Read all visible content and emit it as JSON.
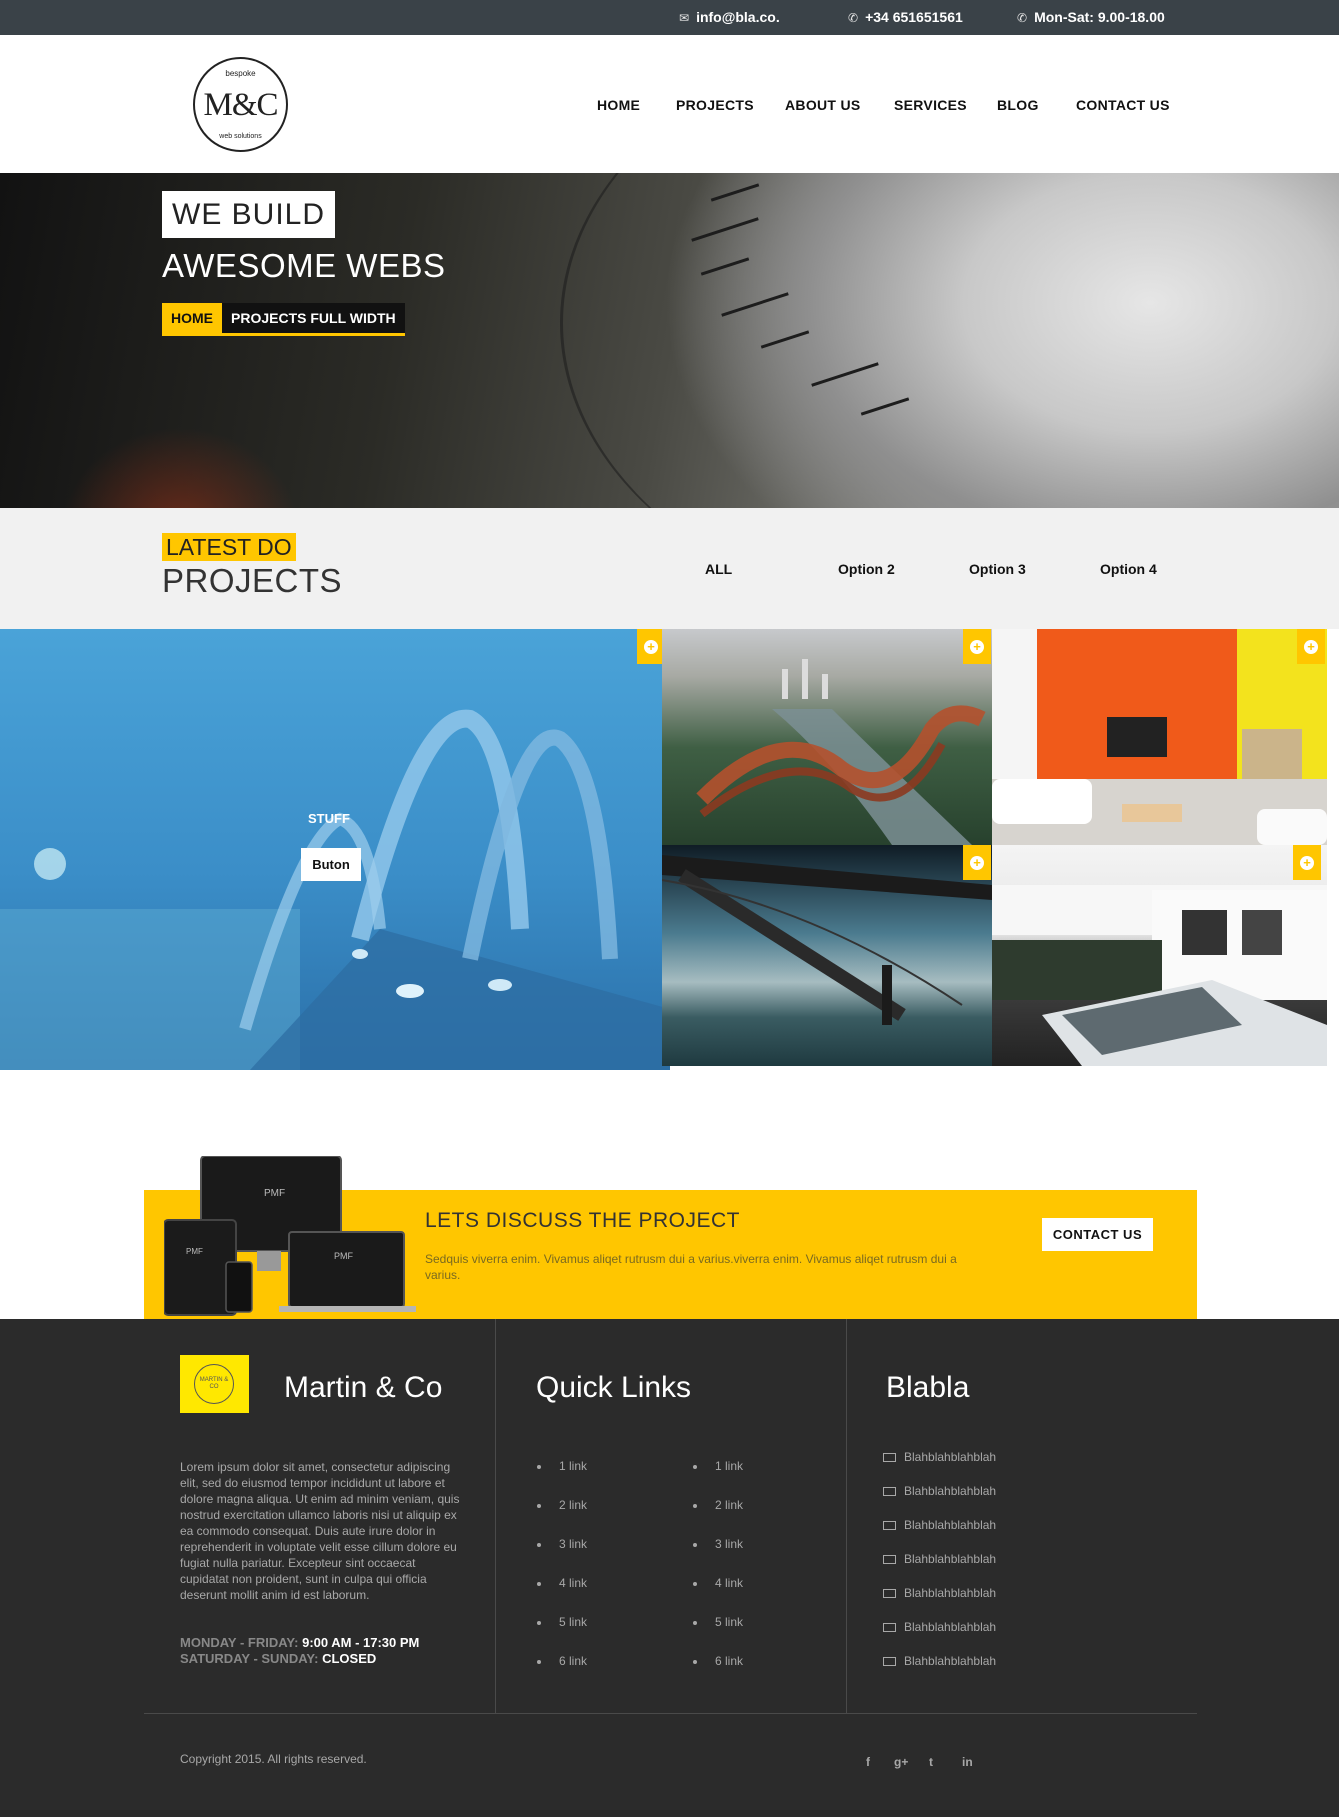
{
  "topbar": {
    "email": "info@bla.co.",
    "phone": "+34 651651561",
    "hours": "Mon-Sat: 9.00-18.00",
    "email_icon": "envelope-icon",
    "phone_icon": "phone-icon",
    "hours_icon": "phone-icon"
  },
  "logo": {
    "text": "M&C",
    "top_text": "bespoke",
    "bottom_text": "web solutions"
  },
  "nav": [
    "HOME",
    "PROJECTS",
    "ABOUT US",
    "SERVICES",
    "BLOG",
    "CONTACT US"
  ],
  "hero": {
    "line1": "WE BUILD",
    "line2": "AWESOME WEBS",
    "breadcrumb_home": "HOME",
    "breadcrumb_current": "PROJECTS FULL WIDTH"
  },
  "projects": {
    "latest": "LATEST DO",
    "title": "PROJECTS",
    "filters": [
      "ALL",
      "Option 2",
      "Option 3",
      "Option 4"
    ],
    "featured_label": "STUFF",
    "featured_button": "Buton"
  },
  "cta": {
    "title": "LETS DISCUSS THE PROJECT",
    "description": "Sedquis viverra enim. Vivamus aliqet rutrusm dui a varius.viverra enim. Vivamus aliqet rutrusm dui a varius.",
    "button": "CONTACT US",
    "device_brand": "PMF"
  },
  "footer": {
    "brand": "Martin & Co",
    "logo_text": "MARTIN & CO",
    "about": "Lorem ipsum dolor sit amet, consectetur adipiscing elit, sed do eiusmod tempor incididunt ut labore et dolore magna aliqua. Ut enim ad minim veniam, quis nostrud exercitation ullamco laboris nisi ut aliquip ex ea commodo consequat. Duis aute irure dolor in reprehenderit in voluptate velit esse cillum dolore eu fugiat nulla pariatur. Excepteur sint occaecat cupidatat non proident, sunt in culpa qui officia deserunt mollit anim id est laborum.",
    "hours1_label": "MONDAY - FRIDAY:",
    "hours1_value": "9:00 AM - 17:30 PM",
    "hours2_label": "SATURDAY - SUNDAY:",
    "hours2_value": "CLOSED",
    "quick_links_title": "Quick Links",
    "links_col1": [
      "1 link",
      "2 link",
      "3 link",
      "4 link",
      "5 link",
      "6 link"
    ],
    "links_col2": [
      "1 link",
      "2 link",
      "3 link",
      "4 link",
      "5 link",
      "6 link"
    ],
    "blabla_title": "Blabla",
    "blabla_items": [
      "Blahblahblahblah",
      "Blahblahblahblah",
      "Blahblahblahblah",
      "Blahblahblahblah",
      "Blahblahblahblah",
      "Blahblahblahblah",
      "Blahblahblahblah"
    ],
    "copyright": "Copyright 2015. All rights reserved.",
    "social": [
      "f",
      "g+",
      "t",
      "in"
    ],
    "social_icons": [
      "facebook-icon",
      "google-plus-icon",
      "twitter-icon",
      "linkedin-icon"
    ]
  },
  "colors": {
    "accent": "#ffc600",
    "topbar": "#3a4248",
    "footer": "#2b2b2b",
    "light_section": "#f1f1f1"
  }
}
